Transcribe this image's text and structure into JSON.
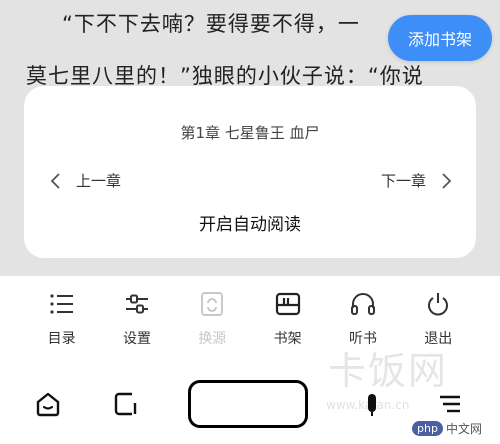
{
  "reader": {
    "line1": "“下不下去喃？要得要不得，一",
    "line2": "莫七里八里的！”独眼的小伙子说：“你说"
  },
  "shelf_button": {
    "label": "添加书架"
  },
  "chapter_card": {
    "title": "第1章 七星鲁王 血尸",
    "prev_label": "上一章",
    "next_label": "下一章",
    "auto_read_label": "开启自动阅读"
  },
  "toolbar": {
    "items": [
      {
        "label": "目录",
        "icon": "list-icon"
      },
      {
        "label": "设置",
        "icon": "sliders-icon"
      },
      {
        "label": "换源",
        "icon": "switch-source-icon",
        "disabled": true
      },
      {
        "label": "书架",
        "icon": "bookshelf-icon"
      },
      {
        "label": "听书",
        "icon": "headphones-icon"
      },
      {
        "label": "退出",
        "icon": "power-icon"
      }
    ]
  },
  "navbar": {
    "icons": [
      "home-icon",
      "tabs-icon",
      "mic-icon",
      "menu-icon"
    ]
  },
  "watermark": {
    "text": "卡饭网",
    "url": "www.kafan.cn",
    "badge_mark": "php",
    "badge_text": "中文网"
  },
  "colors": {
    "accent": "#3e8ef7",
    "page_bg": "#e3e3e3",
    "disabled": "#c8c8c8"
  }
}
